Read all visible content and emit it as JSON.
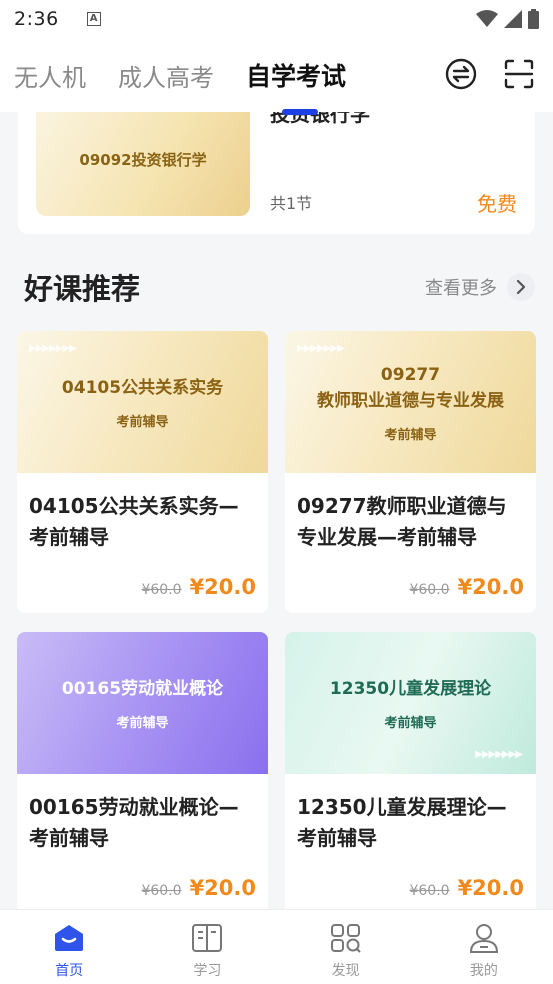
{
  "status_bar": {
    "time": "2:36",
    "notification_letter": "A"
  },
  "top_nav": {
    "tabs": [
      {
        "label": "无人机"
      },
      {
        "label": "成人高考"
      },
      {
        "label": "自学考试"
      }
    ],
    "active_tab": "自学考试",
    "icons": [
      "exchange-icon",
      "scan-icon"
    ]
  },
  "previous_course": {
    "thumb_text": "09092投资银行学",
    "title": "投资银行学",
    "lessons": "共1节",
    "price": "免费"
  },
  "section": {
    "title": "好课推荐",
    "see_more": "查看更多"
  },
  "courses": [
    {
      "thumb_code": "04105公共关系实务",
      "thumb_sub": "考前辅导",
      "title": "04105公共关系实务—考前辅导",
      "old_price": "¥60.0",
      "price": "¥20.0"
    },
    {
      "thumb_code": "09277",
      "thumb_name": "教师职业道德与专业发展",
      "thumb_sub": "考前辅导",
      "title": "09277教师职业道德与专业发展—考前辅导",
      "old_price": "¥60.0",
      "price": "¥20.0"
    },
    {
      "thumb_code": "00165劳动就业概论",
      "thumb_sub": "考前辅导",
      "title": "00165劳动就业概论—考前辅导",
      "old_price": "¥60.0",
      "price": "¥20.0"
    },
    {
      "thumb_code": "12350儿童发展理论",
      "thumb_sub": "考前辅导",
      "title": "12350儿童发展理论—考前辅导",
      "old_price": "¥60.0",
      "price": "¥20.0"
    }
  ],
  "bottom_nav": {
    "items": [
      {
        "label": "首页",
        "icon": "home-icon"
      },
      {
        "label": "学习",
        "icon": "book-icon"
      },
      {
        "label": "发现",
        "icon": "discover-icon"
      },
      {
        "label": "我的",
        "icon": "profile-icon"
      }
    ],
    "active": "首页"
  },
  "colors": {
    "accent": "#2f54eb",
    "price": "#f08a1c",
    "tab_indicator": "#1e3fe6"
  }
}
